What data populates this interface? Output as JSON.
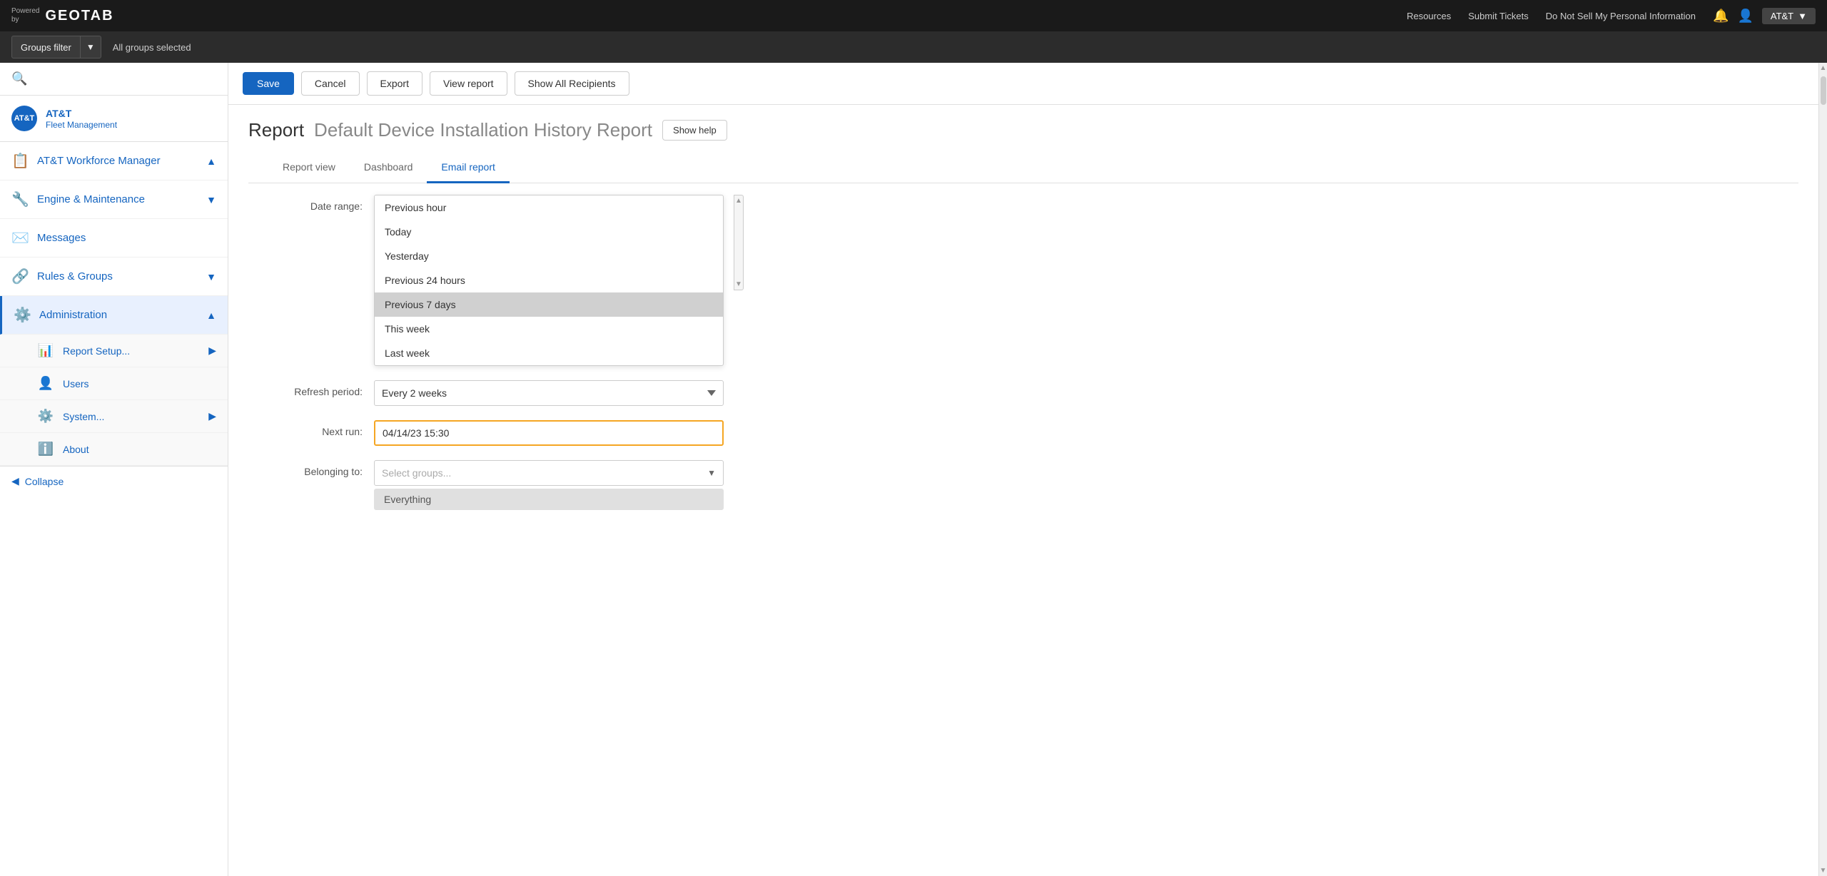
{
  "topnav": {
    "powered_by": "Powered\nby",
    "logo_text": "GEOTAB",
    "links": [
      "Resources",
      "Submit Tickets",
      "Do Not Sell My Personal Information"
    ],
    "notification_icon": "🔔",
    "user_icon": "👤",
    "user_label": "AT&T"
  },
  "filterbar": {
    "groups_filter_label": "Groups filter",
    "caret": "▼",
    "selected_text": "All groups selected"
  },
  "sidebar": {
    "company_initials": "AT&T",
    "company_name": "AT&T",
    "company_sub": "Fleet Management",
    "items": [
      {
        "id": "att-workforce",
        "label": "AT&T Workforce Manager",
        "icon": "📋",
        "has_chevron": true,
        "chevron": "▲"
      },
      {
        "id": "engine-maintenance",
        "label": "Engine & Maintenance",
        "icon": "🔧",
        "has_chevron": true,
        "chevron": "▼"
      },
      {
        "id": "messages",
        "label": "Messages",
        "icon": "✉️",
        "has_chevron": false
      },
      {
        "id": "rules-groups",
        "label": "Rules & Groups",
        "icon": "🔗",
        "has_chevron": true,
        "chevron": "▼"
      },
      {
        "id": "administration",
        "label": "Administration",
        "icon": "⚙️",
        "has_chevron": true,
        "chevron": "▲",
        "active": true
      }
    ],
    "sub_items": [
      {
        "id": "report-setup",
        "label": "Report Setup...",
        "icon": "📊",
        "has_chevron": true,
        "chevron": "▶"
      },
      {
        "id": "users",
        "label": "Users",
        "icon": "👤",
        "has_chevron": false
      },
      {
        "id": "system",
        "label": "System...",
        "icon": "⚙️",
        "has_chevron": true,
        "chevron": "▶"
      },
      {
        "id": "about",
        "label": "About",
        "icon": "ℹ️",
        "has_chevron": false
      }
    ],
    "collapse_label": "Collapse",
    "collapse_icon": "◀"
  },
  "toolbar": {
    "save_label": "Save",
    "cancel_label": "Cancel",
    "export_label": "Export",
    "view_report_label": "View report",
    "show_all_recipients_label": "Show All Recipients"
  },
  "report": {
    "title_word": "Report",
    "title_name": "Default Device Installation History Report",
    "show_help_label": "Show help"
  },
  "tabs": [
    {
      "id": "report-view",
      "label": "Report view",
      "active": false
    },
    {
      "id": "dashboard",
      "label": "Dashboard",
      "active": false
    },
    {
      "id": "email-report",
      "label": "Email report",
      "active": true
    }
  ],
  "form": {
    "data_range_label": "Date range:",
    "dropdown_options": [
      {
        "value": "previous-hour",
        "label": "Previous hour",
        "selected": false
      },
      {
        "value": "today",
        "label": "Today",
        "selected": false
      },
      {
        "value": "yesterday",
        "label": "Yesterday",
        "selected": false
      },
      {
        "value": "previous-24",
        "label": "Previous 24 hours",
        "selected": false
      },
      {
        "value": "previous-7",
        "label": "Previous 7 days",
        "selected": true
      },
      {
        "value": "this-week",
        "label": "This week",
        "selected": false
      },
      {
        "value": "last-week",
        "label": "Last week",
        "selected": false
      }
    ],
    "refresh_period_label": "Refresh period:",
    "refresh_period_value": "Every 2 weeks",
    "next_run_label": "Next run:",
    "next_run_value": "04/14/23 15:30",
    "belonging_to_label": "Belonging to:",
    "select_groups_placeholder": "Select groups...",
    "everything_tag": "Everything",
    "caret": "▼"
  }
}
